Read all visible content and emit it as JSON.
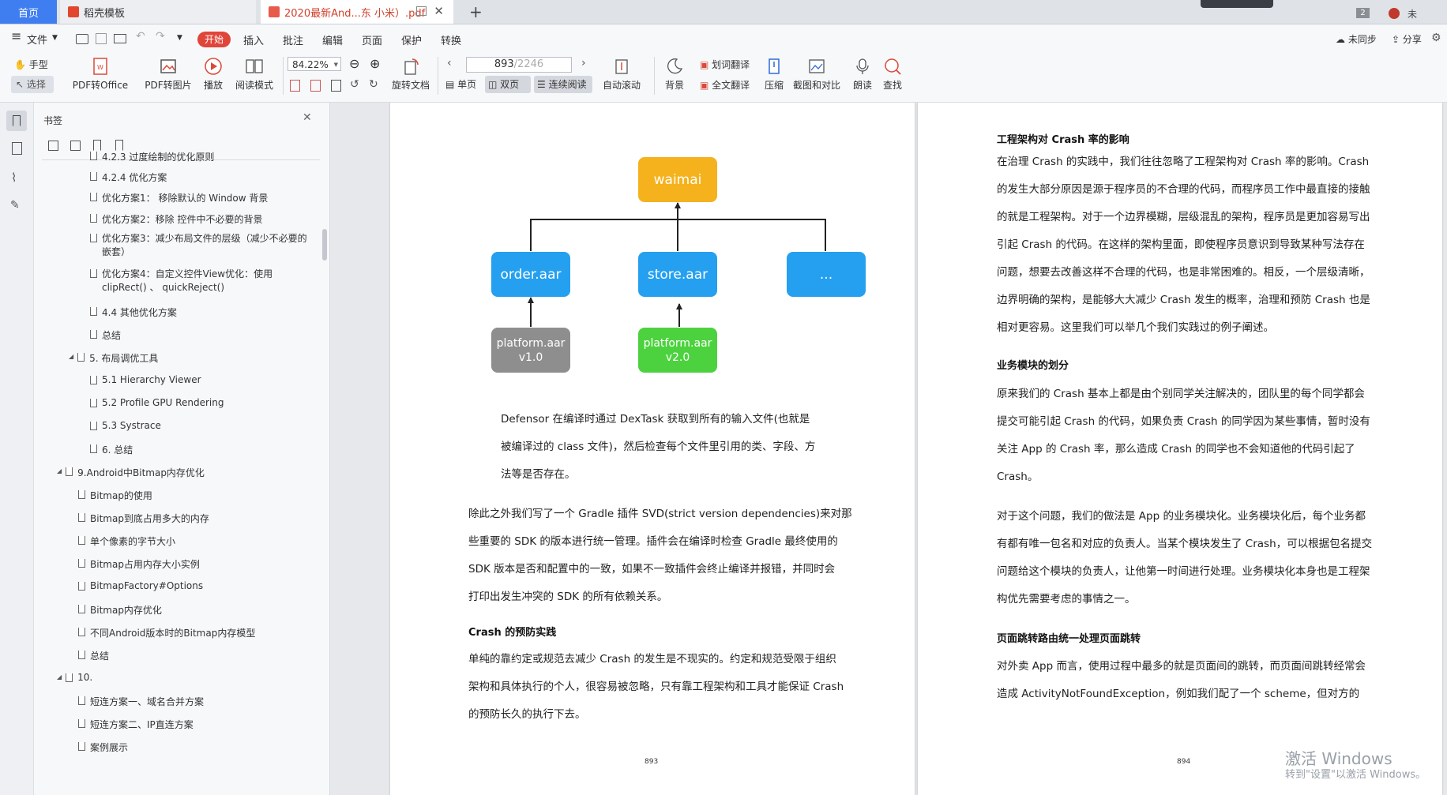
{
  "tabs": {
    "home": "首页",
    "template": "稻壳模板",
    "pdf": "2020最新And...东 小米）.pdf",
    "badge": "2",
    "user": "未"
  },
  "menu": {
    "file": "文件",
    "start": "开始",
    "insert": "插入",
    "annotate": "批注",
    "edit": "编辑",
    "page": "页面",
    "protect": "保护",
    "convert": "转换",
    "unsync": "未同步",
    "share": "分享"
  },
  "ribbon": {
    "hand": "手型",
    "select": "选择",
    "pdf_to_office": "PDF转Office",
    "pdf_to_image": "PDF转图片",
    "play": "播放",
    "read_mode": "阅读模式",
    "zoom": "84.22%",
    "rotate": "旋转文档",
    "page_current": "893",
    "page_total": "/2246",
    "single": "单页",
    "double": "双页",
    "continuous": "连续阅读",
    "autoscroll": "自动滚动",
    "background": "背景",
    "word_translate": "划词翻译",
    "full_translate": "全文翻译",
    "compress": "压缩",
    "screenshot": "截图和对比",
    "read_aloud": "朗读",
    "find": "查找"
  },
  "bookmarks": {
    "title": "书签",
    "items": [
      "4.2.3 过度绘制的优化原则",
      "4.2.4 优化方案",
      "优化方案1： 移除默认的 Window 背景",
      "优化方案2：移除 控件中不必要的背景",
      "优化方案3：减少布局文件的层级（减少不必要的嵌套）",
      "优化方案4：自定义控件View优化：使用 clipRect() 、 quickReject()",
      "4.4 其他优化方案",
      "总结",
      "5. 布局调优工具",
      "5.1 Hierarchy Viewer",
      "5.2 Profile GPU Rendering",
      "5.3 Systrace",
      "6. 总结",
      "9.Android中Bitmap内存优化",
      "Bitmap的使用",
      "Bitmap到底占用多大的内存",
      "单个像素的字节大小",
      "Bitmap占用内存大小实例",
      "BitmapFactory#Options",
      "Bitmap内存优化",
      "不同Android版本时的Bitmap内存模型",
      "总结",
      "10.",
      "短连方案一、域名合并方案",
      "短连方案二、IP直连方案",
      "案例展示"
    ]
  },
  "page_left": {
    "diagram": {
      "top": "waimai",
      "mid1": "order.aar",
      "mid2": "store.aar",
      "mid3": "...",
      "bot1a": "platform.aar",
      "bot1b": "v1.0",
      "bot2a": "platform.aar",
      "bot2b": "v2.0"
    },
    "quote": [
      "Defensor 在编译时通过 DexTask 获取到所有的输入文件(也就是",
      "被编译过的 class 文件)，然后检查每个文件里引用的类、字段、方",
      "法等是否存在。"
    ],
    "para1": [
      "除此之外我们写了一个 Gradle 插件 SVD(strict version dependencies)来对那",
      "些重要的 SDK 的版本进行统一管理。插件会在编译时检查 Gradle 最终使用的",
      "SDK 版本是否和配置中的一致，如果不一致插件会终止编译并报错，并同时会",
      "打印出发生冲突的 SDK 的所有依赖关系。"
    ],
    "heading": "Crash 的预防实践",
    "para2": [
      "单纯的靠约定或规范去减少 Crash 的发生是不现实的。约定和规范受限于组织",
      "架构和具体执行的个人，很容易被忽略，只有靠工程架构和工具才能保证 Crash",
      "的预防长久的执行下去。"
    ],
    "page_number": "893"
  },
  "page_right": {
    "heading1": "工程架构对 Crash 率的影响",
    "para1": [
      "在治理 Crash 的实践中，我们往往忽略了工程架构对 Crash 率的影响。Crash",
      "的发生大部分原因是源于程序员的不合理的代码，而程序员工作中最直接的接触",
      "的就是工程架构。对于一个边界模糊，层级混乱的架构，程序员是更加容易写出",
      "引起 Crash 的代码。在这样的架构里面，即使程序员意识到导致某种写法存在",
      "问题，想要去改善这样不合理的代码，也是非常困难的。相反，一个层级清晰，",
      "边界明确的架构，是能够大大减少 Crash 发生的概率，治理和预防 Crash 也是",
      "相对更容易。这里我们可以举几个我们实践过的例子阐述。"
    ],
    "heading2": "业务模块的划分",
    "para2": [
      "原来我们的 Crash 基本上都是由个别同学关注解决的，团队里的每个同学都会",
      "提交可能引起 Crash 的代码，如果负责 Crash 的同学因为某些事情，暂时没有",
      "关注 App 的 Crash 率，那么造成 Crash 的同学也不会知道他的代码引起了",
      "Crash。"
    ],
    "para3": [
      "对于这个问题，我们的做法是 App 的业务模块化。业务模块化后，每个业务都",
      "有都有唯一包名和对应的负责人。当某个模块发生了 Crash，可以根据包名提交",
      "问题给这个模块的负责人，让他第一时间进行处理。业务模块化本身也是工程架",
      "构优先需要考虑的事情之一。"
    ],
    "heading3": "页面跳转路由统一处理页面跳转",
    "para4": [
      "对外卖 App 而言，使用过程中最多的就是页面间的跳转，而页面间跳转经常会",
      "造成 ActivityNotFoundException，例如我们配了一个 scheme，但对方的"
    ],
    "page_number": "894"
  },
  "watermark": {
    "line1": "激活 Windows",
    "line2": "转到\"设置\"以激活 Windows。"
  },
  "colors": {
    "orange": "#f5b21d",
    "blue": "#25a0f0",
    "gray": "#8e8e8e",
    "green": "#4cd23e",
    "accent_red": "#e0453a"
  }
}
